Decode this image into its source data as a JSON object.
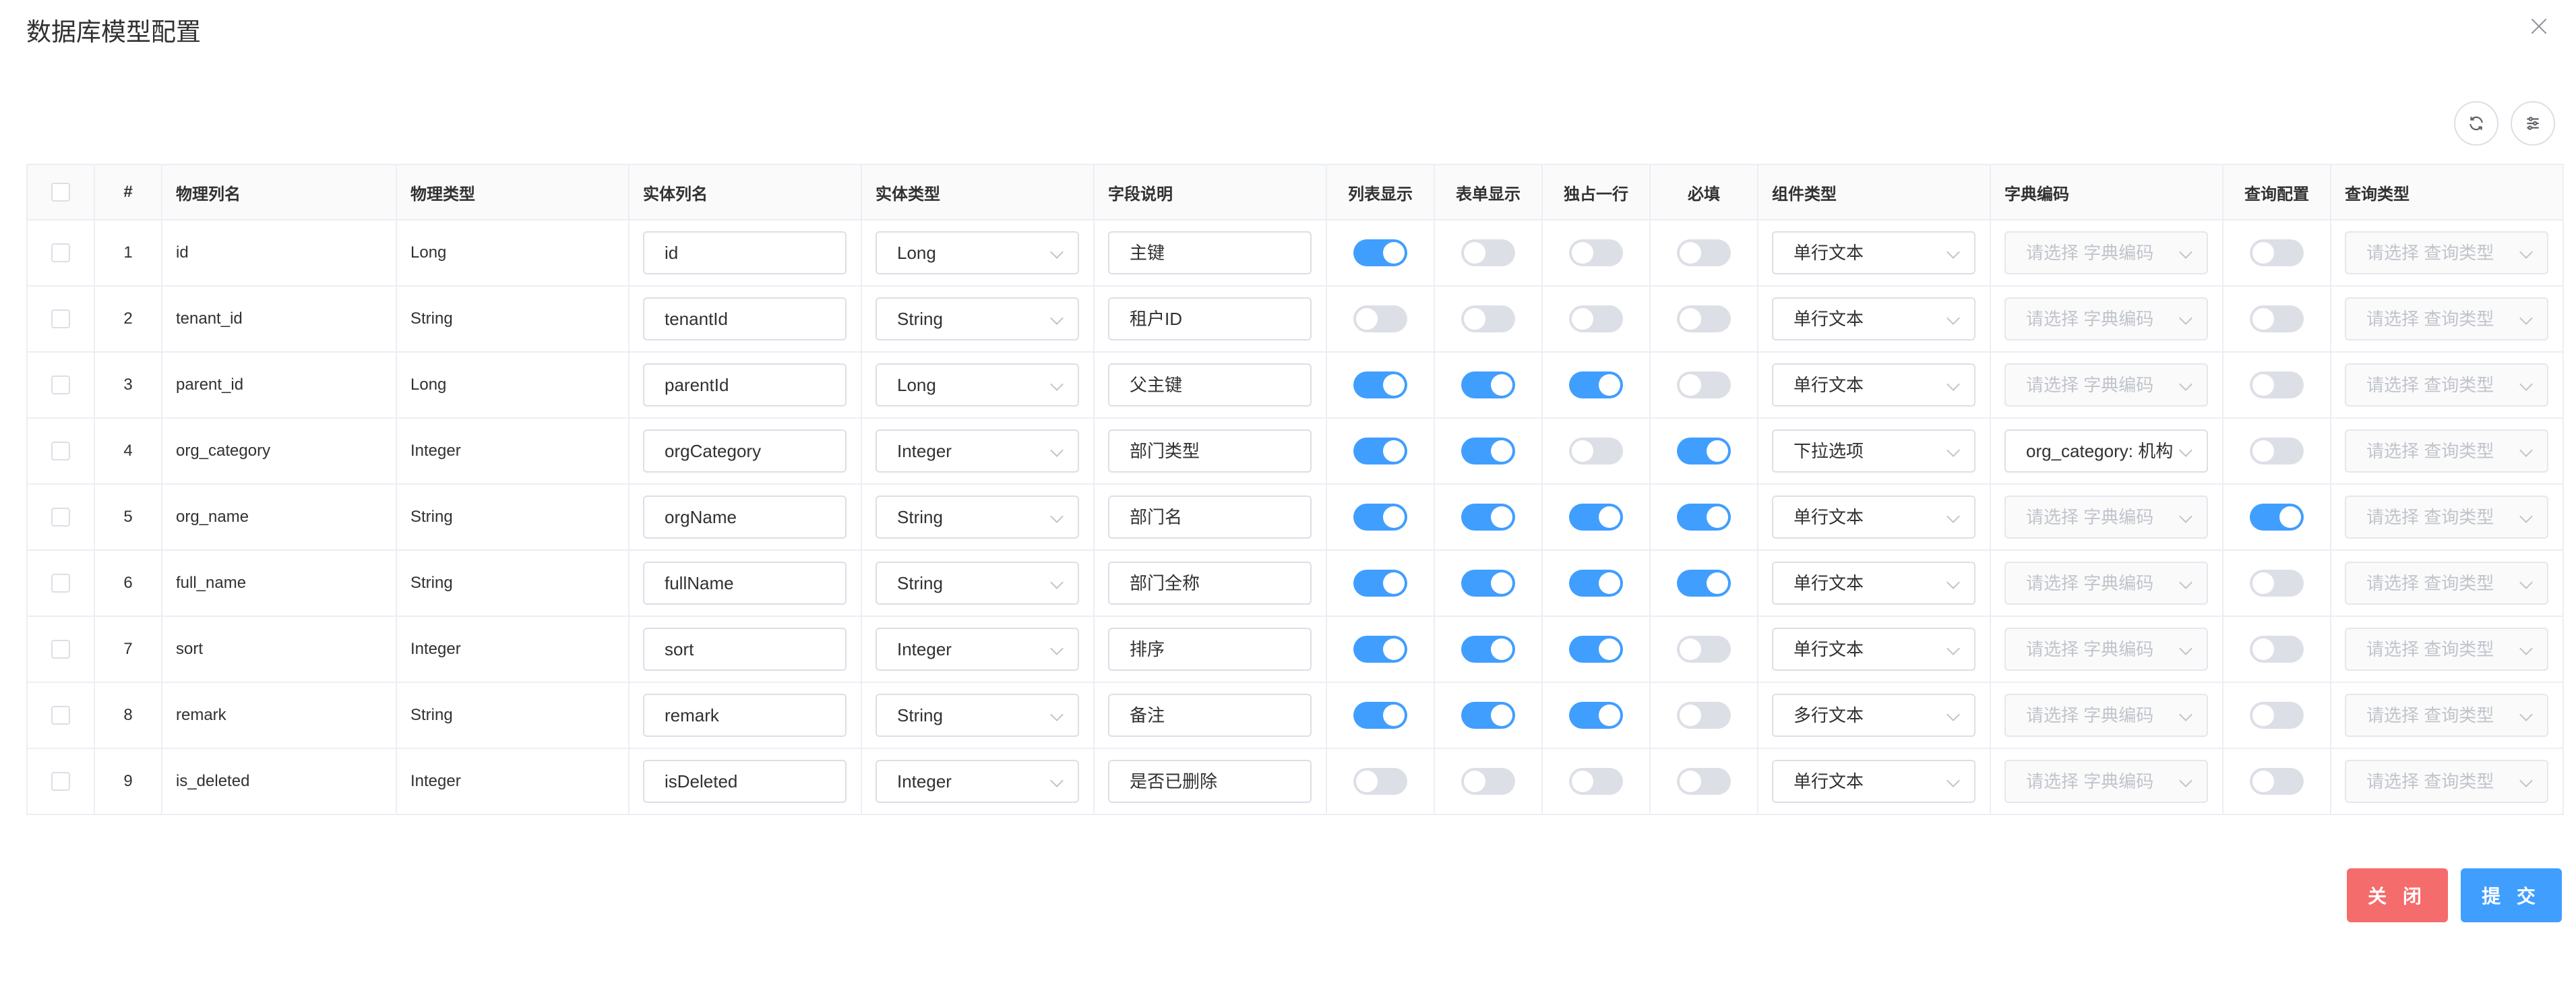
{
  "title": "数据库模型配置",
  "columns": [
    "#",
    "物理列名",
    "物理类型",
    "实体列名",
    "实体类型",
    "字段说明",
    "列表显示",
    "表单显示",
    "独占一行",
    "必填",
    "组件类型",
    "字典编码",
    "查询配置",
    "查询类型"
  ],
  "placeholders": {
    "dict": "请选择 字典编码",
    "query_type": "请选择 查询类型"
  },
  "rows": [
    {
      "idx": "1",
      "phys_name": "id",
      "phys_type": "Long",
      "entity_name": "id",
      "entity_type": "Long",
      "desc": "主键",
      "list_show": true,
      "form_show": false,
      "exclusive": false,
      "required": false,
      "comp_type": "单行文本",
      "dict": "",
      "query_cfg": false
    },
    {
      "idx": "2",
      "phys_name": "tenant_id",
      "phys_type": "String",
      "entity_name": "tenantId",
      "entity_type": "String",
      "desc": "租户ID",
      "list_show": false,
      "form_show": false,
      "exclusive": false,
      "required": false,
      "comp_type": "单行文本",
      "dict": "",
      "query_cfg": false
    },
    {
      "idx": "3",
      "phys_name": "parent_id",
      "phys_type": "Long",
      "entity_name": "parentId",
      "entity_type": "Long",
      "desc": "父主键",
      "list_show": true,
      "form_show": true,
      "exclusive": true,
      "required": false,
      "comp_type": "单行文本",
      "dict": "",
      "query_cfg": false
    },
    {
      "idx": "4",
      "phys_name": "org_category",
      "phys_type": "Integer",
      "entity_name": "orgCategory",
      "entity_type": "Integer",
      "desc": "部门类型",
      "list_show": true,
      "form_show": true,
      "exclusive": false,
      "required": true,
      "comp_type": "下拉选项",
      "dict": "org_category: 机构",
      "query_cfg": false
    },
    {
      "idx": "5",
      "phys_name": "org_name",
      "phys_type": "String",
      "entity_name": "orgName",
      "entity_type": "String",
      "desc": "部门名",
      "list_show": true,
      "form_show": true,
      "exclusive": true,
      "required": true,
      "comp_type": "单行文本",
      "dict": "",
      "query_cfg": true
    },
    {
      "idx": "6",
      "phys_name": "full_name",
      "phys_type": "String",
      "entity_name": "fullName",
      "entity_type": "String",
      "desc": "部门全称",
      "list_show": true,
      "form_show": true,
      "exclusive": true,
      "required": true,
      "comp_type": "单行文本",
      "dict": "",
      "query_cfg": false
    },
    {
      "idx": "7",
      "phys_name": "sort",
      "phys_type": "Integer",
      "entity_name": "sort",
      "entity_type": "Integer",
      "desc": "排序",
      "list_show": true,
      "form_show": true,
      "exclusive": true,
      "required": false,
      "comp_type": "单行文本",
      "dict": "",
      "query_cfg": false
    },
    {
      "idx": "8",
      "phys_name": "remark",
      "phys_type": "String",
      "entity_name": "remark",
      "entity_type": "String",
      "desc": "备注",
      "list_show": true,
      "form_show": true,
      "exclusive": true,
      "required": false,
      "comp_type": "多行文本",
      "dict": "",
      "query_cfg": false
    },
    {
      "idx": "9",
      "phys_name": "is_deleted",
      "phys_type": "Integer",
      "entity_name": "isDeleted",
      "entity_type": "Integer",
      "desc": "是否已删除",
      "list_show": false,
      "form_show": false,
      "exclusive": false,
      "required": false,
      "comp_type": "单行文本",
      "dict": "",
      "query_cfg": false
    }
  ],
  "buttons": {
    "close": "关 闭",
    "submit": "提 交"
  },
  "toolbar": {
    "refresh_icon": "refresh-icon",
    "settings_icon": "column-settings-icon"
  },
  "colors": {
    "primary": "#409eff",
    "danger": "#f56c6c",
    "switch_off": "#dcdfe6"
  }
}
